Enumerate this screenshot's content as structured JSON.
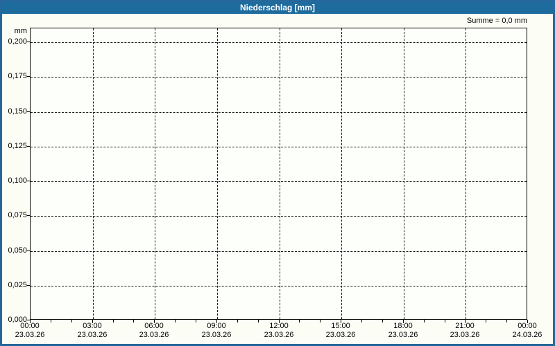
{
  "window": {
    "title": "Niederschlag [mm]"
  },
  "header": {
    "sum_label": "Summe = 0,0 mm"
  },
  "chart_data": {
    "type": "bar",
    "title": "Niederschlag [mm]",
    "ylabel": "mm",
    "unit": "mm",
    "ylim": [
      0,
      0.21
    ],
    "grid": true,
    "legend": "none",
    "y_ticks": [
      {
        "value": 0.0,
        "label": "0,000"
      },
      {
        "value": 0.025,
        "label": "0,025"
      },
      {
        "value": 0.05,
        "label": "0,050"
      },
      {
        "value": 0.075,
        "label": "0,075"
      },
      {
        "value": 0.1,
        "label": "0,100"
      },
      {
        "value": 0.125,
        "label": "0,125"
      },
      {
        "value": 0.15,
        "label": "0,150"
      },
      {
        "value": 0.175,
        "label": "0,175"
      },
      {
        "value": 0.2,
        "label": "0,200"
      }
    ],
    "x_ticks": [
      {
        "time": "00:00",
        "date": "23.03.26"
      },
      {
        "time": "03:00",
        "date": "23.03.26"
      },
      {
        "time": "06:00",
        "date": "23.03.26"
      },
      {
        "time": "09:00",
        "date": "23.03.26"
      },
      {
        "time": "12:00",
        "date": "23.03.26"
      },
      {
        "time": "15:00",
        "date": "23.03.26"
      },
      {
        "time": "18:00",
        "date": "23.03.26"
      },
      {
        "time": "21:00",
        "date": "23.03.26"
      },
      {
        "time": "00:00",
        "date": "24.03.26"
      }
    ],
    "x_minor_ticks_per_interval": 2,
    "series": [
      {
        "name": "Niederschlag",
        "values": [],
        "sum_mm": 0.0
      }
    ],
    "sum_label": "Summe = 0,0 mm",
    "colors": {
      "frame_blue": "#1E6B9E",
      "background": "#FCFEF5",
      "grid": "#1A1A1A",
      "text": "#000000"
    }
  }
}
